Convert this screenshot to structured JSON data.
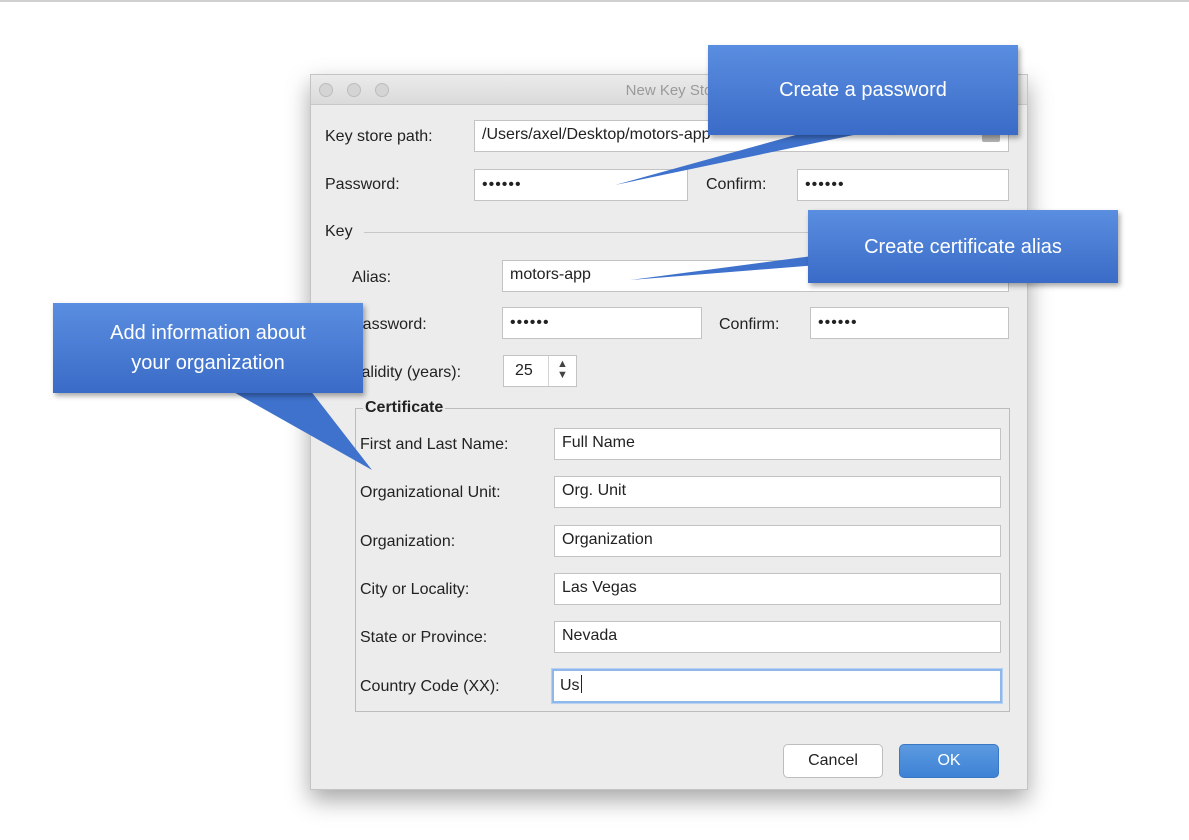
{
  "window": {
    "title": "New Key Sto"
  },
  "keystore": {
    "path_label": "Key store path:",
    "path_value": "/Users/axel/Desktop/motors-app",
    "password_label": "Password:",
    "password_value": "••••••",
    "confirm_label": "Confirm:",
    "confirm_value": "••••••"
  },
  "key": {
    "section_label": "Key",
    "alias_label": "Alias:",
    "alias_value": "motors-app",
    "password_label": "Password:",
    "password_value": "••••••",
    "confirm_label": "Confirm:",
    "confirm_value": "••••••",
    "validity_label": "Validity (years):",
    "validity_value": "25",
    "stepper_arrows": "▲\n▼"
  },
  "certificate": {
    "legend": "Certificate",
    "fields": [
      {
        "label": "First and Last Name:",
        "value": "Full Name"
      },
      {
        "label": "Organizational Unit:",
        "value": "Org. Unit"
      },
      {
        "label": "Organization:",
        "value": "Organization"
      },
      {
        "label": "City or Locality:",
        "value": "Las Vegas"
      },
      {
        "label": "State or Province:",
        "value": "Nevada"
      },
      {
        "label": "Country Code (XX):",
        "value": "Us"
      }
    ]
  },
  "buttons": {
    "cancel": "Cancel",
    "ok": "OK"
  },
  "callouts": {
    "password": "Create a password",
    "alias": "Create certificate alias",
    "organization_line1": "Add information about",
    "organization_line2": "your organization"
  },
  "colors": {
    "callout": "#4a7fd6",
    "ok_button": "#4a8ad9",
    "focus_ring": "#8fb7ea"
  }
}
